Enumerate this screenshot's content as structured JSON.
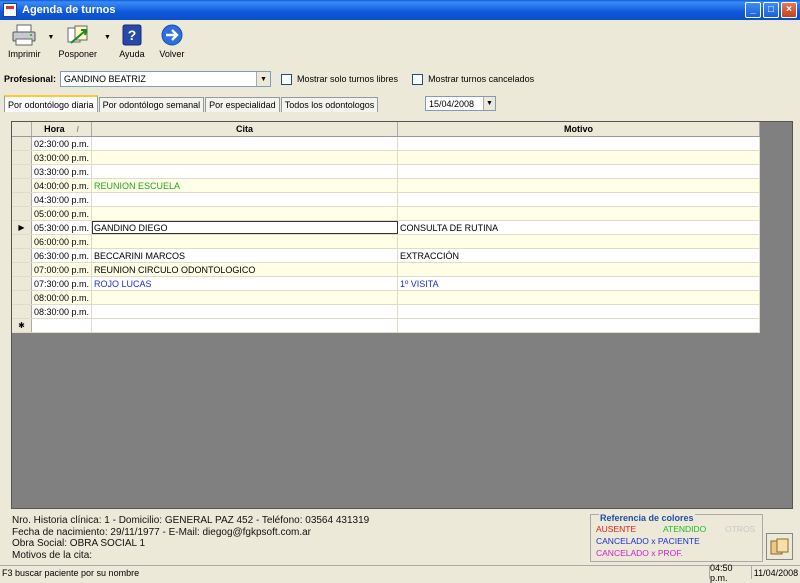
{
  "window": {
    "title": "Agenda de turnos"
  },
  "toolbar": {
    "print_label": "Imprimir",
    "postpone_label": "Posponer",
    "help_label": "Ayuda",
    "back_label": "Volver"
  },
  "filter": {
    "profesional_label": "Profesional:",
    "profesional_value": "GANDINO BEATRIZ",
    "free_only_label": "Mostrar solo turnos libres",
    "show_cancelled_label": "Mostrar turnos cancelados"
  },
  "tabs": [
    {
      "label": "Por odontólogo diaria"
    },
    {
      "label": "Por odontólogo semanal"
    },
    {
      "label": "Por especialidad"
    },
    {
      "label": "Todos los odontologos"
    }
  ],
  "date_value": "15/04/2008",
  "grid": {
    "headers": {
      "hora": "Hora",
      "cita": "Cita",
      "motivo": "Motivo"
    },
    "rows": [
      {
        "hora": "02:30:00 p.m.",
        "cita": "",
        "motivo": "",
        "color": "#000000"
      },
      {
        "hora": "03:00:00 p.m.",
        "cita": "",
        "motivo": "",
        "color": "#000000"
      },
      {
        "hora": "03:30:00 p.m.",
        "cita": "",
        "motivo": "",
        "color": "#000000"
      },
      {
        "hora": "04:00:00 p.m.",
        "cita": "REUNION ESCUELA",
        "motivo": "",
        "color": "#1EA81E"
      },
      {
        "hora": "04:30:00 p.m.",
        "cita": "",
        "motivo": "",
        "color": "#000000"
      },
      {
        "hora": "05:00:00 p.m.",
        "cita": "",
        "motivo": "",
        "color": "#000000"
      },
      {
        "hora": "05:30:00 p.m.",
        "cita": "GANDINO DIEGO",
        "motivo": "CONSULTA DE RUTINA",
        "color": "#000000"
      },
      {
        "hora": "06:00:00 p.m.",
        "cita": "",
        "motivo": "",
        "color": "#000000"
      },
      {
        "hora": "06:30:00 p.m.",
        "cita": "BECCARINI MARCOS",
        "motivo": "EXTRACCIÓN",
        "color": "#000000"
      },
      {
        "hora": "07:00:00 p.m.",
        "cita": "REUNION CIRCULO ODONTOLOGICO",
        "motivo": "",
        "color": "#000000"
      },
      {
        "hora": "07:30:00 p.m.",
        "cita": "ROJO LUCAS",
        "motivo": "1º VISITA",
        "color": "#1A2FD0"
      },
      {
        "hora": "08:00:00 p.m.",
        "cita": "",
        "motivo": "",
        "color": "#000000"
      },
      {
        "hora": "08:30:00 p.m.",
        "cita": "",
        "motivo": "",
        "color": "#000000"
      }
    ]
  },
  "info": {
    "line1": "Nro. Historia clínica: 1  -  Domicilio: GENERAL PAZ 452   -   Teléfono: 03564 431319",
    "line2": "Fecha de nacimiento: 29/11/1977   - E-Mail: diegog@fgkpsoft.com.ar",
    "line3": "Obra Social: OBRA SOCIAL 1",
    "line4": "Motivos de la cita:"
  },
  "legend": {
    "title": "Referencia de colores",
    "ausente": "AUSENTE",
    "atendido": "ATENDIDO",
    "otros": "OTROS",
    "cancel_paciente": "CANCELADO x PACIENTE",
    "cancel_prof": "CANCELADO x PROF.",
    "colors": {
      "ausente": "#E02020",
      "atendido": "#22B822",
      "otros": "#C8C8C8",
      "cancel_paciente": "#1A2FD0",
      "cancel_prof": "#D020D0"
    }
  },
  "status": {
    "hint": "F3 buscar paciente por su nombre",
    "time": "04:50 p.m.",
    "date": "11/04/2008"
  }
}
